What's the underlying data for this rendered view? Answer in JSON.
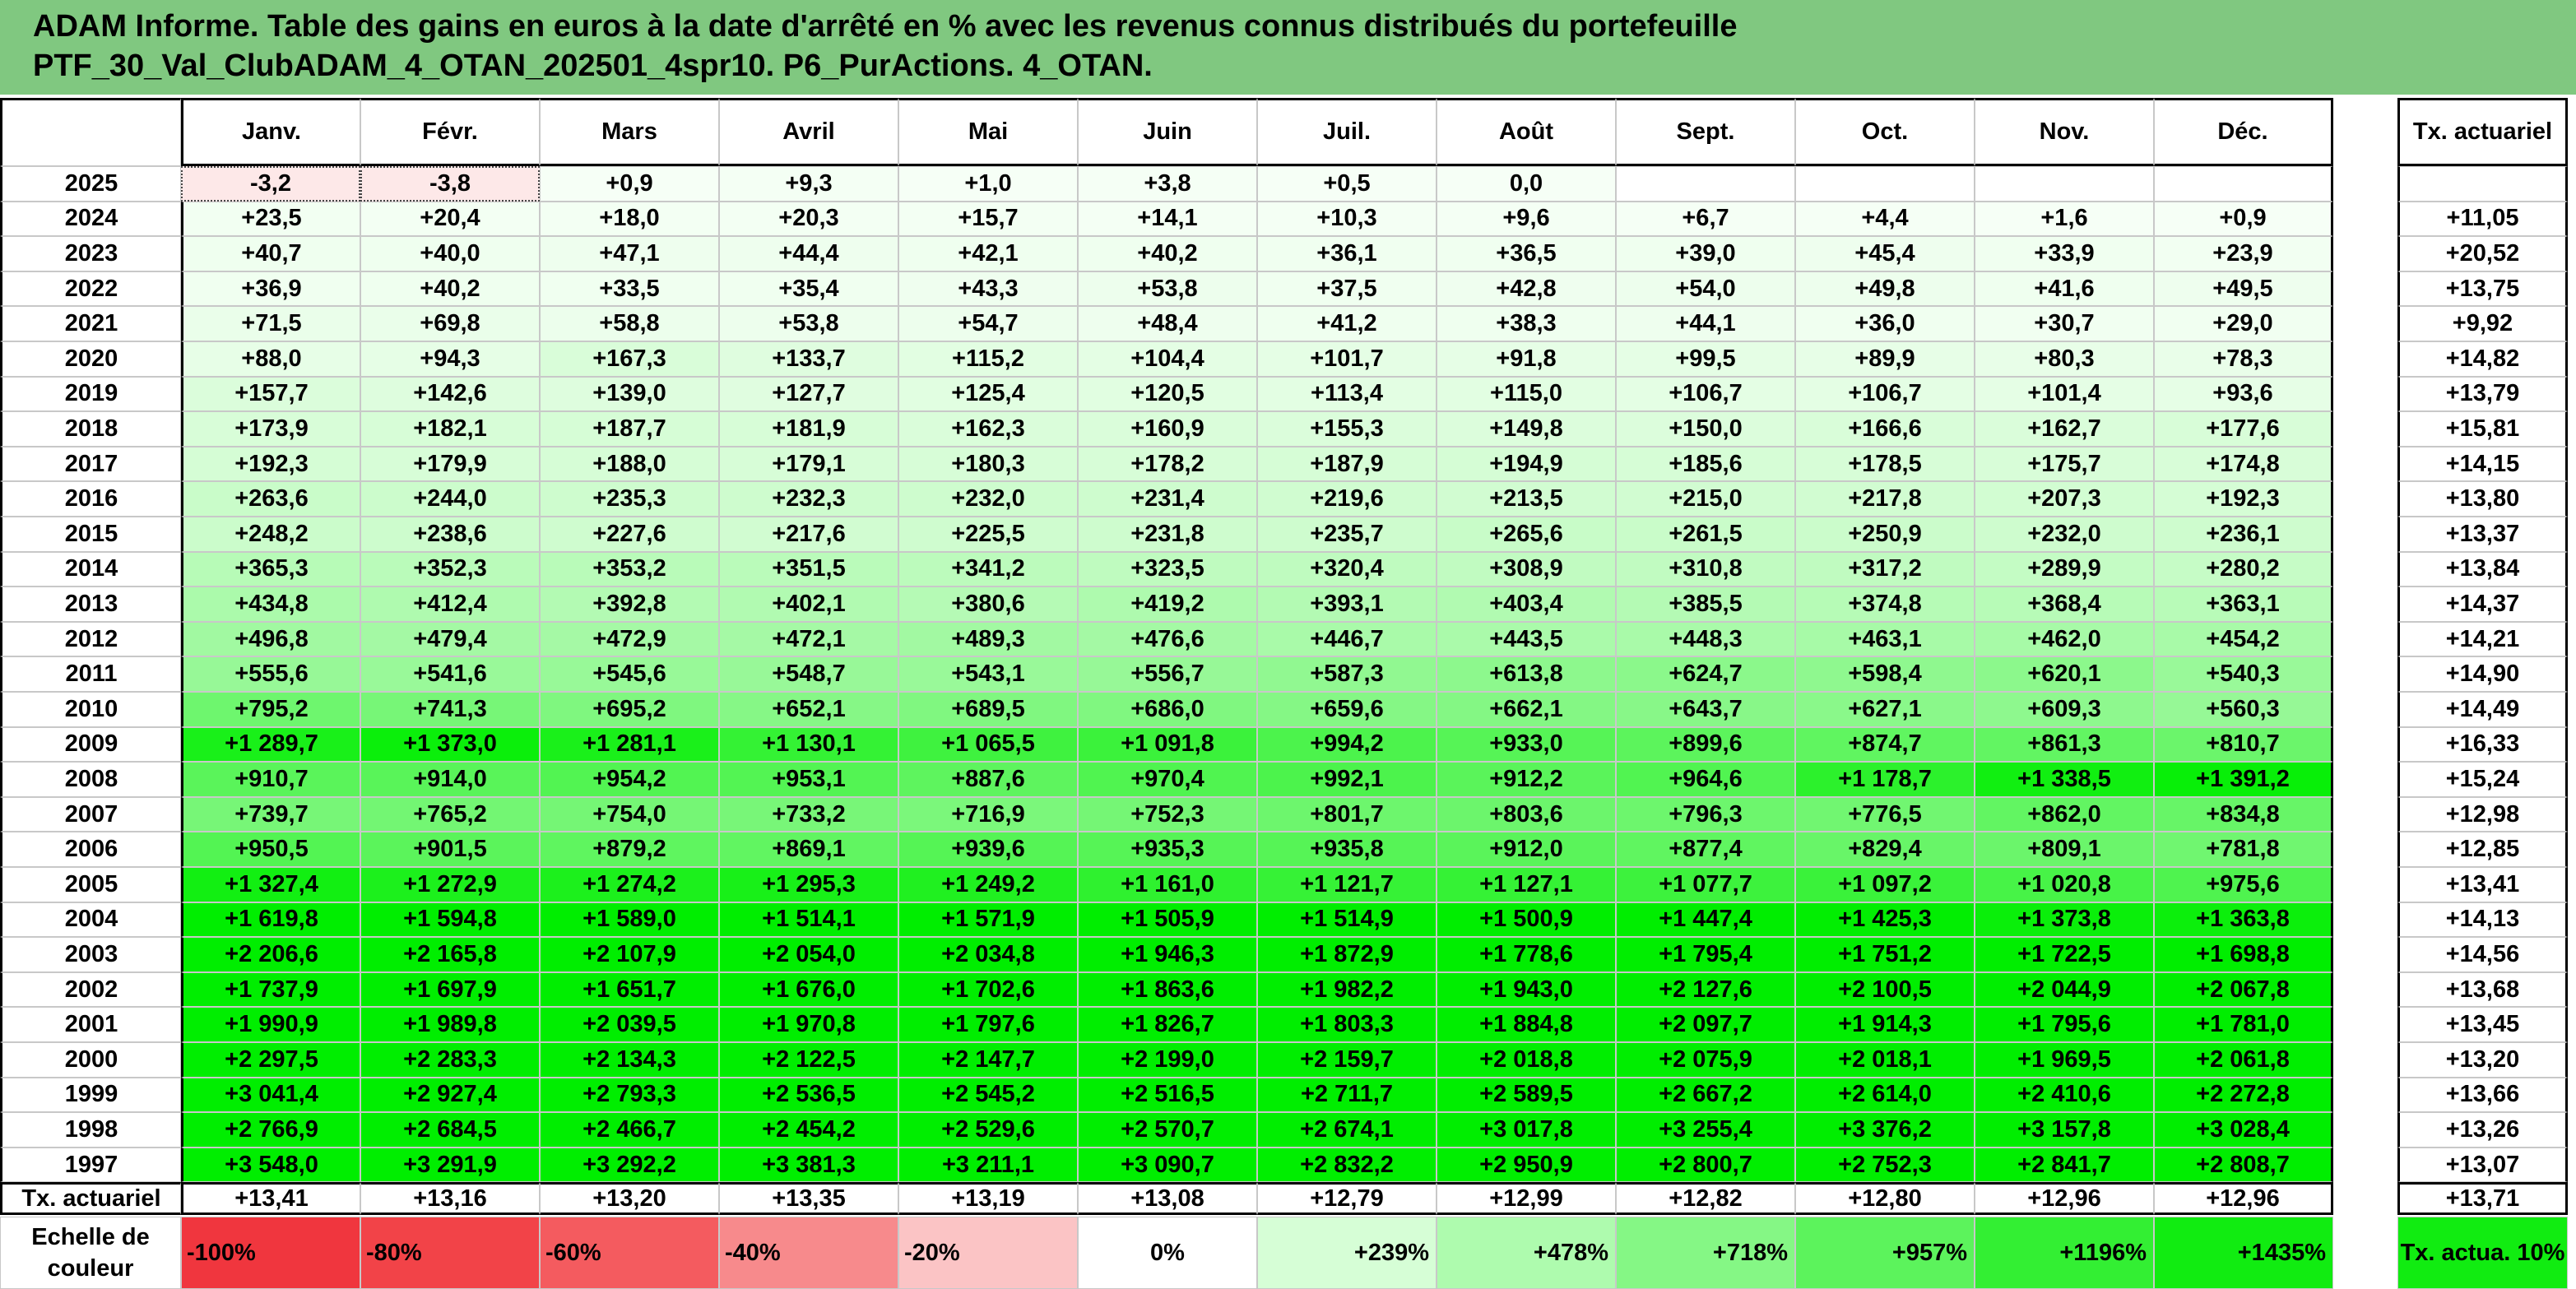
{
  "title": {
    "line1": "ADAM Informe. Table des gains en euros à la date d'arrêté en % avec les revenus connus distribués du portefeuille",
    "line2": "PTF_30_Val_ClubADAM_4_OTAN_202501_4spr10. P6_PurActions. 4_OTAN."
  },
  "months": [
    "Janv.",
    "Févr.",
    "Mars",
    "Avril",
    "Mai",
    "Juin",
    "Juil.",
    "Août",
    "Sept.",
    "Oct.",
    "Nov.",
    "Déc."
  ],
  "tx_header": "Tx. actuariel",
  "rows": [
    {
      "year": "2025",
      "values": [
        "-3,2",
        "-3,8",
        "+0,9",
        "+9,3",
        "+1,0",
        "+3,8",
        "+0,5",
        "0,0",
        "",
        "",
        "",
        ""
      ],
      "tx": ""
    },
    {
      "year": "2024",
      "values": [
        "+23,5",
        "+20,4",
        "+18,0",
        "+20,3",
        "+15,7",
        "+14,1",
        "+10,3",
        "+9,6",
        "+6,7",
        "+4,4",
        "+1,6",
        "+0,9"
      ],
      "tx": "+11,05"
    },
    {
      "year": "2023",
      "values": [
        "+40,7",
        "+40,0",
        "+47,1",
        "+44,4",
        "+42,1",
        "+40,2",
        "+36,1",
        "+36,5",
        "+39,0",
        "+45,4",
        "+33,9",
        "+23,9"
      ],
      "tx": "+20,52"
    },
    {
      "year": "2022",
      "values": [
        "+36,9",
        "+40,2",
        "+33,5",
        "+35,4",
        "+43,3",
        "+53,8",
        "+37,5",
        "+42,8",
        "+54,0",
        "+49,8",
        "+41,6",
        "+49,5"
      ],
      "tx": "+13,75"
    },
    {
      "year": "2021",
      "values": [
        "+71,5",
        "+69,8",
        "+58,8",
        "+53,8",
        "+54,7",
        "+48,4",
        "+41,2",
        "+38,3",
        "+44,1",
        "+36,0",
        "+30,7",
        "+29,0"
      ],
      "tx": "+9,92"
    },
    {
      "year": "2020",
      "values": [
        "+88,0",
        "+94,3",
        "+167,3",
        "+133,7",
        "+115,2",
        "+104,4",
        "+101,7",
        "+91,8",
        "+99,5",
        "+89,9",
        "+80,3",
        "+78,3"
      ],
      "tx": "+14,82"
    },
    {
      "year": "2019",
      "values": [
        "+157,7",
        "+142,6",
        "+139,0",
        "+127,7",
        "+125,4",
        "+120,5",
        "+113,4",
        "+115,0",
        "+106,7",
        "+106,7",
        "+101,4",
        "+93,6"
      ],
      "tx": "+13,79"
    },
    {
      "year": "2018",
      "values": [
        "+173,9",
        "+182,1",
        "+187,7",
        "+181,9",
        "+162,3",
        "+160,9",
        "+155,3",
        "+149,8",
        "+150,0",
        "+166,6",
        "+162,7",
        "+177,6"
      ],
      "tx": "+15,81"
    },
    {
      "year": "2017",
      "values": [
        "+192,3",
        "+179,9",
        "+188,0",
        "+179,1",
        "+180,3",
        "+178,2",
        "+187,9",
        "+194,9",
        "+185,6",
        "+178,5",
        "+175,7",
        "+174,8"
      ],
      "tx": "+14,15"
    },
    {
      "year": "2016",
      "values": [
        "+263,6",
        "+244,0",
        "+235,3",
        "+232,3",
        "+232,0",
        "+231,4",
        "+219,6",
        "+213,5",
        "+215,0",
        "+217,8",
        "+207,3",
        "+192,3"
      ],
      "tx": "+13,80"
    },
    {
      "year": "2015",
      "values": [
        "+248,2",
        "+238,6",
        "+227,6",
        "+217,6",
        "+225,5",
        "+231,8",
        "+235,7",
        "+265,6",
        "+261,5",
        "+250,9",
        "+232,0",
        "+236,1"
      ],
      "tx": "+13,37"
    },
    {
      "year": "2014",
      "values": [
        "+365,3",
        "+352,3",
        "+353,2",
        "+351,5",
        "+341,2",
        "+323,5",
        "+320,4",
        "+308,9",
        "+310,8",
        "+317,2",
        "+289,9",
        "+280,2"
      ],
      "tx": "+13,84"
    },
    {
      "year": "2013",
      "values": [
        "+434,8",
        "+412,4",
        "+392,8",
        "+402,1",
        "+380,6",
        "+419,2",
        "+393,1",
        "+403,4",
        "+385,5",
        "+374,8",
        "+368,4",
        "+363,1"
      ],
      "tx": "+14,37"
    },
    {
      "year": "2012",
      "values": [
        "+496,8",
        "+479,4",
        "+472,9",
        "+472,1",
        "+489,3",
        "+476,6",
        "+446,7",
        "+443,5",
        "+448,3",
        "+463,1",
        "+462,0",
        "+454,2"
      ],
      "tx": "+14,21"
    },
    {
      "year": "2011",
      "values": [
        "+555,6",
        "+541,6",
        "+545,6",
        "+548,7",
        "+543,1",
        "+556,7",
        "+587,3",
        "+613,8",
        "+624,7",
        "+598,4",
        "+620,1",
        "+540,3"
      ],
      "tx": "+14,90"
    },
    {
      "year": "2010",
      "values": [
        "+795,2",
        "+741,3",
        "+695,2",
        "+652,1",
        "+689,5",
        "+686,0",
        "+659,6",
        "+662,1",
        "+643,7",
        "+627,1",
        "+609,3",
        "+560,3"
      ],
      "tx": "+14,49"
    },
    {
      "year": "2009",
      "values": [
        "+1 289,7",
        "+1 373,0",
        "+1 281,1",
        "+1 130,1",
        "+1 065,5",
        "+1 091,8",
        "+994,2",
        "+933,0",
        "+899,6",
        "+874,7",
        "+861,3",
        "+810,7"
      ],
      "tx": "+16,33"
    },
    {
      "year": "2008",
      "values": [
        "+910,7",
        "+914,0",
        "+954,2",
        "+953,1",
        "+887,6",
        "+970,4",
        "+992,1",
        "+912,2",
        "+964,6",
        "+1 178,7",
        "+1 338,5",
        "+1 391,2"
      ],
      "tx": "+15,24"
    },
    {
      "year": "2007",
      "values": [
        "+739,7",
        "+765,2",
        "+754,0",
        "+733,2",
        "+716,9",
        "+752,3",
        "+801,7",
        "+803,6",
        "+796,3",
        "+776,5",
        "+862,0",
        "+834,8"
      ],
      "tx": "+12,98"
    },
    {
      "year": "2006",
      "values": [
        "+950,5",
        "+901,5",
        "+879,2",
        "+869,1",
        "+939,6",
        "+935,3",
        "+935,8",
        "+912,0",
        "+877,4",
        "+829,4",
        "+809,1",
        "+781,8"
      ],
      "tx": "+12,85"
    },
    {
      "year": "2005",
      "values": [
        "+1 327,4",
        "+1 272,9",
        "+1 274,2",
        "+1 295,3",
        "+1 249,2",
        "+1 161,0",
        "+1 121,7",
        "+1 127,1",
        "+1 077,7",
        "+1 097,2",
        "+1 020,8",
        "+975,6"
      ],
      "tx": "+13,41"
    },
    {
      "year": "2004",
      "values": [
        "+1 619,8",
        "+1 594,8",
        "+1 589,0",
        "+1 514,1",
        "+1 571,9",
        "+1 505,9",
        "+1 514,9",
        "+1 500,9",
        "+1 447,4",
        "+1 425,3",
        "+1 373,8",
        "+1 363,8"
      ],
      "tx": "+14,13"
    },
    {
      "year": "2003",
      "values": [
        "+2 206,6",
        "+2 165,8",
        "+2 107,9",
        "+2 054,0",
        "+2 034,8",
        "+1 946,3",
        "+1 872,9",
        "+1 778,6",
        "+1 795,4",
        "+1 751,2",
        "+1 722,5",
        "+1 698,8"
      ],
      "tx": "+14,56"
    },
    {
      "year": "2002",
      "values": [
        "+1 737,9",
        "+1 697,9",
        "+1 651,7",
        "+1 676,0",
        "+1 702,6",
        "+1 863,6",
        "+1 982,2",
        "+1 943,0",
        "+2 127,6",
        "+2 100,5",
        "+2 044,9",
        "+2 067,8"
      ],
      "tx": "+13,68"
    },
    {
      "year": "2001",
      "values": [
        "+1 990,9",
        "+1 989,8",
        "+2 039,5",
        "+1 970,8",
        "+1 797,6",
        "+1 826,7",
        "+1 803,3",
        "+1 884,8",
        "+2 097,7",
        "+1 914,3",
        "+1 795,6",
        "+1 781,0"
      ],
      "tx": "+13,45"
    },
    {
      "year": "2000",
      "values": [
        "+2 297,5",
        "+2 283,3",
        "+2 134,3",
        "+2 122,5",
        "+2 147,7",
        "+2 199,0",
        "+2 159,7",
        "+2 018,8",
        "+2 075,9",
        "+2 018,1",
        "+1 969,5",
        "+2 061,8"
      ],
      "tx": "+13,20"
    },
    {
      "year": "1999",
      "values": [
        "+3 041,4",
        "+2 927,4",
        "+2 793,3",
        "+2 536,5",
        "+2 545,2",
        "+2 516,5",
        "+2 711,7",
        "+2 589,5",
        "+2 667,2",
        "+2 614,0",
        "+2 410,6",
        "+2 272,8"
      ],
      "tx": "+13,66"
    },
    {
      "year": "1998",
      "values": [
        "+2 766,9",
        "+2 684,5",
        "+2 466,7",
        "+2 454,2",
        "+2 529,6",
        "+2 570,7",
        "+2 674,1",
        "+3 017,8",
        "+3 255,4",
        "+3 376,2",
        "+3 157,8",
        "+3 028,4"
      ],
      "tx": "+13,26"
    },
    {
      "year": "1997",
      "values": [
        "+3 548,0",
        "+3 291,9",
        "+3 292,2",
        "+3 381,3",
        "+3 211,1",
        "+3 090,7",
        "+2 832,2",
        "+2 950,9",
        "+2 800,7",
        "+2 752,3",
        "+2 841,7",
        "+2 808,7"
      ],
      "tx": "+13,07"
    }
  ],
  "summary_row": {
    "label": "Tx. actuariel",
    "values": [
      "+13,41",
      "+13,16",
      "+13,20",
      "+13,35",
      "+13,19",
      "+13,08",
      "+12,79",
      "+12,99",
      "+12,82",
      "+12,80",
      "+12,96",
      "+12,96"
    ],
    "tx": "+13,71"
  },
  "scale": {
    "label": "Echelle de couleur",
    "items": [
      {
        "text": "-100%",
        "color": "#f0363e",
        "align": "left"
      },
      {
        "text": "-80%",
        "color": "#f24348",
        "align": "left"
      },
      {
        "text": "-60%",
        "color": "#f45b5f",
        "align": "left"
      },
      {
        "text": "-40%",
        "color": "#f78a8c",
        "align": "left"
      },
      {
        "text": "-20%",
        "color": "#fbc4c5",
        "align": "left"
      },
      {
        "text": "0%",
        "color": "#ffffff",
        "align": "center"
      },
      {
        "text": "+239%",
        "color": "#d6fed6",
        "align": "right"
      },
      {
        "text": "+478%",
        "color": "#aefbae",
        "align": "right"
      },
      {
        "text": "+718%",
        "color": "#85f785",
        "align": "right"
      },
      {
        "text": "+957%",
        "color": "#5cf35c",
        "align": "right"
      },
      {
        "text": "+1196%",
        "color": "#33ef33",
        "align": "right"
      },
      {
        "text": "+1435%",
        "color": "#11ec11",
        "align": "right"
      }
    ],
    "tx_label": "Tx. actua. 10%",
    "tx_color": "#11ec11"
  },
  "colors": {
    "title_bg": "#80c880",
    "negative_cell": "#fde8e8",
    "max_green": "#00ee00",
    "white": "#ffffff"
  }
}
